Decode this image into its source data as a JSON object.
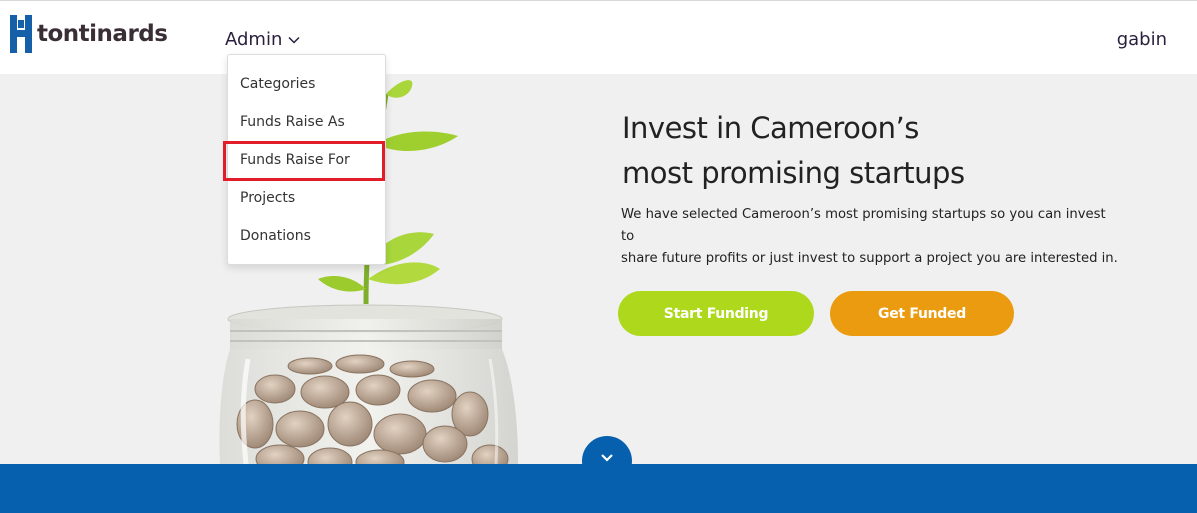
{
  "header": {
    "logo_text": "tontinards",
    "admin_label": "Admin",
    "user_name": "gabin"
  },
  "admin_dropdown": {
    "items": [
      {
        "label": "Categories"
      },
      {
        "label": "Funds Raise As"
      },
      {
        "label": "Funds Raise For"
      },
      {
        "label": "Projects"
      },
      {
        "label": "Donations"
      }
    ]
  },
  "hero": {
    "title_line1": "Invest in Cameroon’s",
    "title_line2": "most promising startups",
    "description_line1": "We have selected Cameroon’s most promising startups so you can invest to",
    "description_line2": "share future profits or just invest to support a project you are interested in.",
    "start_funding_label": "Start Funding",
    "get_funded_label": "Get Funded"
  },
  "colors": {
    "brand_blue": "#0660ad",
    "start_green": "#aed81c",
    "funded_orange": "#ea9b0f",
    "highlight_red": "#e11d2a"
  },
  "icons": {
    "logo": "tontinards-logo-icon",
    "admin_chevron": "chevron-down-icon",
    "scroll": "chevron-down-icon"
  }
}
